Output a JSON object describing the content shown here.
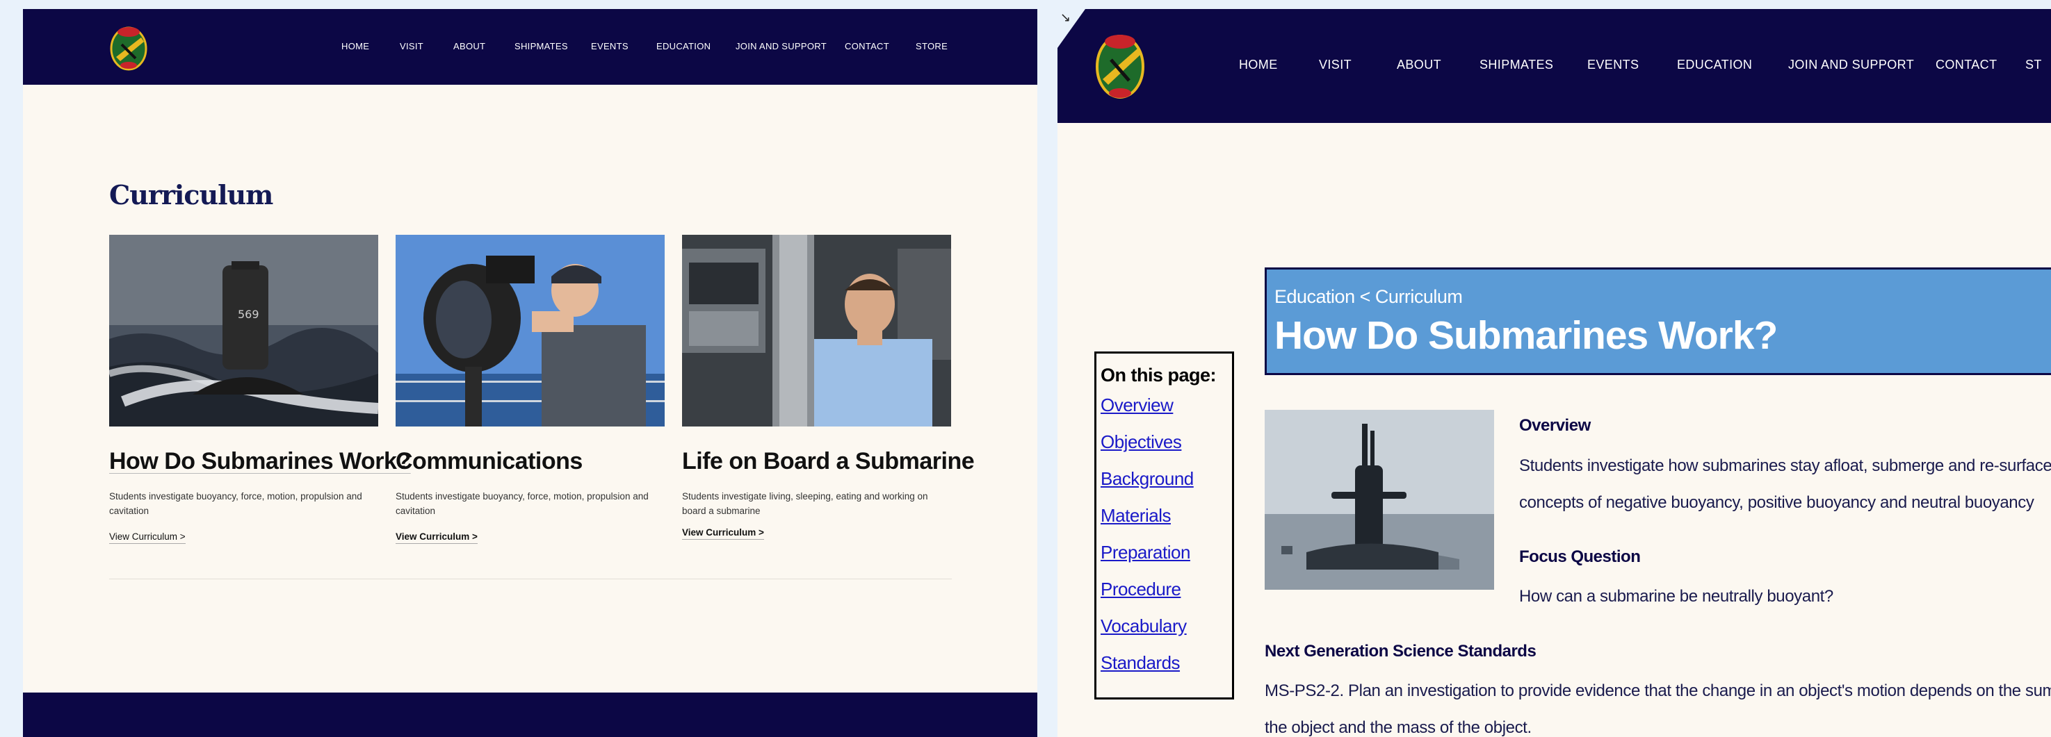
{
  "left": {
    "nav": [
      "HOME",
      "VISIT",
      "ABOUT",
      "SHIPMATES",
      "EVENTS",
      "EDUCATION",
      "JOIN AND SUPPORT",
      "CONTACT",
      "STORE"
    ],
    "section_title": "Curriculum",
    "cards": [
      {
        "title": "How Do Submarines Work?",
        "description": "Students investigate buoyancy, force, motion, propulsion and cavitation",
        "link": "View Curriculum >"
      },
      {
        "title": "Communications",
        "description": "Students investigate buoyancy, force, motion, propulsion and cavitation",
        "link": "View Curriculum >"
      },
      {
        "title": "Life on Board a Submarine",
        "description": "Students investigate living, sleeping, eating and working on board a submarine",
        "link": "View Curriculum >"
      }
    ],
    "sail_number": "569"
  },
  "right": {
    "nav": [
      "HOME",
      "VISIT",
      "ABOUT",
      "SHIPMATES",
      "EVENTS",
      "EDUCATION",
      "JOIN AND SUPPORT",
      "CONTACT",
      "ST"
    ],
    "toc": {
      "heading": "On this page:",
      "links": [
        "Overview",
        "Objectives",
        "Background",
        "Materials",
        "Preparation",
        "Procedure",
        "Vocabulary",
        "Standards"
      ]
    },
    "breadcrumb": "Education < Curriculum",
    "page_title": "How Do Submarines Work?",
    "overview": {
      "heading": "Overview",
      "line1": "Students investigate how submarines stay afloat, submerge and re-surface, learning",
      "line2": "concepts of negative buoyancy, positive buoyancy and neutral buoyancy"
    },
    "focus": {
      "heading": "Focus Question",
      "text": "How can a submarine be neutrally buoyant?"
    },
    "ngss": {
      "heading": "Next Generation Science Standards",
      "line1": "MS-PS2-2. Plan an investigation to provide evidence that the change in an object's motion depends on the sum of the force",
      "line2": "the object and the mass of the object."
    }
  },
  "colors": {
    "navy": "#0c0745",
    "cream": "#fcf8f1",
    "banner_blue": "#5b9bd6",
    "link_blue": "#1a1ac8"
  }
}
